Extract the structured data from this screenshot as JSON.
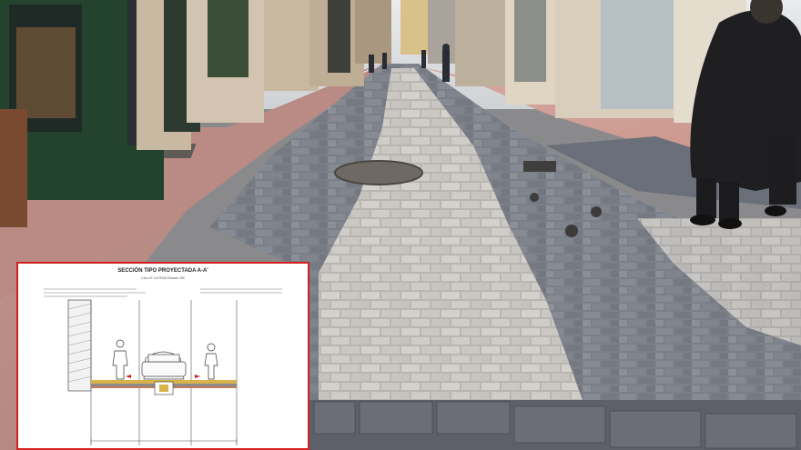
{
  "scene": {
    "description_icons": [
      "shop-front",
      "pedestrian",
      "paved-street",
      "drain-cover"
    ],
    "colors": {
      "pavement_red": "#b7837c",
      "granite_gray": "#7d7f86",
      "light_stone": "#c9c7c4",
      "shop_green": "#23432f",
      "inset_border": "#d32020"
    }
  },
  "inset": {
    "title": "SECCIÓN TIPO PROYECTADA A-A'",
    "subtitle": "CALLE LA RÚA Estado DE"
  }
}
